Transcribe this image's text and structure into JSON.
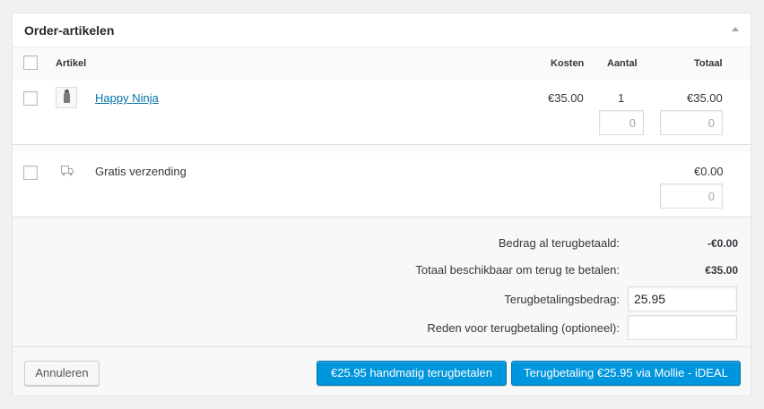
{
  "panel": {
    "title": "Order-artikelen"
  },
  "columns": {
    "item": "Artikel",
    "cost": "Kosten",
    "qty": "Aantal",
    "total": "Totaal"
  },
  "line_item": {
    "name": "Happy Ninja",
    "cost": "€35.00",
    "qty": "1",
    "total": "€35.00",
    "refund_qty_placeholder": "0",
    "refund_total_placeholder": "0"
  },
  "shipping": {
    "name": "Gratis verzending",
    "total": "€0.00",
    "refund_total_placeholder": "0"
  },
  "totals": {
    "refunded_label": "Bedrag al terugbetaald:",
    "refunded_value": "-€0.00",
    "available_label": "Totaal beschikbaar om terug te betalen:",
    "available_value": "€35.00",
    "refund_amount_label": "Terugbetalingsbedrag:",
    "refund_amount_value": "25.95",
    "reason_label": "Reden voor terugbetaling (optioneel):",
    "reason_value": ""
  },
  "actions": {
    "cancel": "Annuleren",
    "manual_refund": "€25.95 handmatig terugbetalen",
    "api_refund": "Terugbetaling €25.95 via Mollie - iDEAL"
  },
  "colors": {
    "primary": "#0096dd",
    "link": "#0073aa"
  }
}
